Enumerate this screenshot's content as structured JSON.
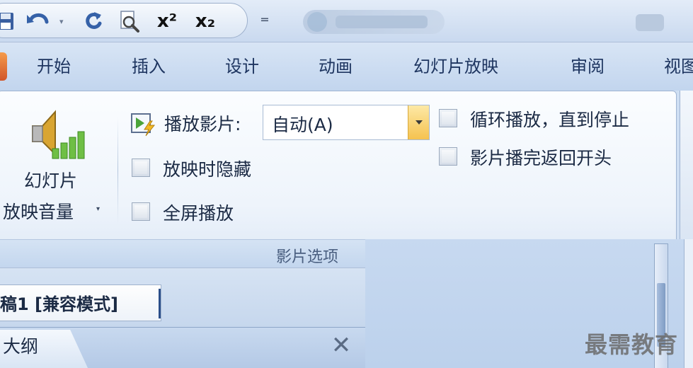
{
  "quick_access": {
    "buttons": [
      {
        "name": "save-icon"
      },
      {
        "name": "undo-icon"
      },
      {
        "name": "redo-icon"
      },
      {
        "name": "print-preview-icon"
      },
      {
        "name": "superscript-icon",
        "glyph": "x²"
      },
      {
        "name": "subscript-icon",
        "glyph": "x₂"
      }
    ],
    "customize_glyph": "="
  },
  "tabs": [
    "开始",
    "插入",
    "设计",
    "动画",
    "幻灯片放映",
    "审阅",
    "视图"
  ],
  "ribbon": {
    "volume_button": {
      "label_line1": "幻灯片",
      "label_line2": "放映音量",
      "arrow": "▾",
      "icon": "speaker-volume-icon"
    },
    "play_movie": {
      "label": "播放影片:",
      "value": "自动(A)",
      "icon": "play-movie-icon"
    },
    "checkboxes": {
      "hide_during_show": {
        "label": "放映时隐藏",
        "checked": false
      },
      "fullscreen": {
        "label": "全屏播放",
        "checked": false
      },
      "loop_until_stopped": {
        "label": "循环播放，直到停止",
        "checked": false
      },
      "rewind_after_play": {
        "label": "影片播完返回开头",
        "checked": false
      }
    },
    "group_label": "影片选项"
  },
  "document_tab": {
    "label": "稿1 [兼容模式]"
  },
  "outline_pane": {
    "tab_label": "大纲",
    "close_glyph": "✕"
  },
  "watermark": "最需教育",
  "colors": {
    "ribbon_bg": "#eef4fb",
    "tab_text": "#1e3560",
    "combo_button": "#f5c24f",
    "workspace": "#c7d9f0"
  }
}
